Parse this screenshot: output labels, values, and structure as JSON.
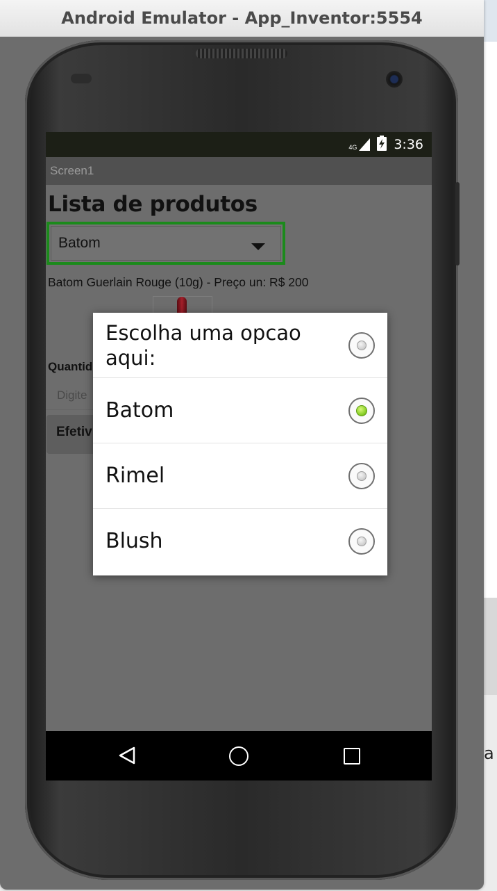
{
  "window": {
    "title": "Android Emulator - App_Inventor:5554"
  },
  "background": {
    "edge_letter": "a"
  },
  "status_bar": {
    "network": "4G",
    "time": "3:36"
  },
  "app_bar": {
    "title": "Screen1"
  },
  "screen": {
    "heading": "Lista de produtos",
    "spinner": {
      "selected": "Batom"
    },
    "product_info": "Batom Guerlain Rouge (10g) - Preço un: R$  200",
    "quantity_label": "Quantid",
    "quantity_placeholder": "Digite",
    "submit_label": "Efetiv"
  },
  "dialog": {
    "title": "Escolha uma opcao aqui:",
    "options": [
      {
        "label": "Batom",
        "checked": true
      },
      {
        "label": "Rimel",
        "checked": false
      },
      {
        "label": "Blush",
        "checked": false
      }
    ],
    "accent_color": "#8cd12a"
  },
  "nav_bar": {
    "icons": [
      "back-icon",
      "home-icon",
      "recents-icon"
    ]
  }
}
